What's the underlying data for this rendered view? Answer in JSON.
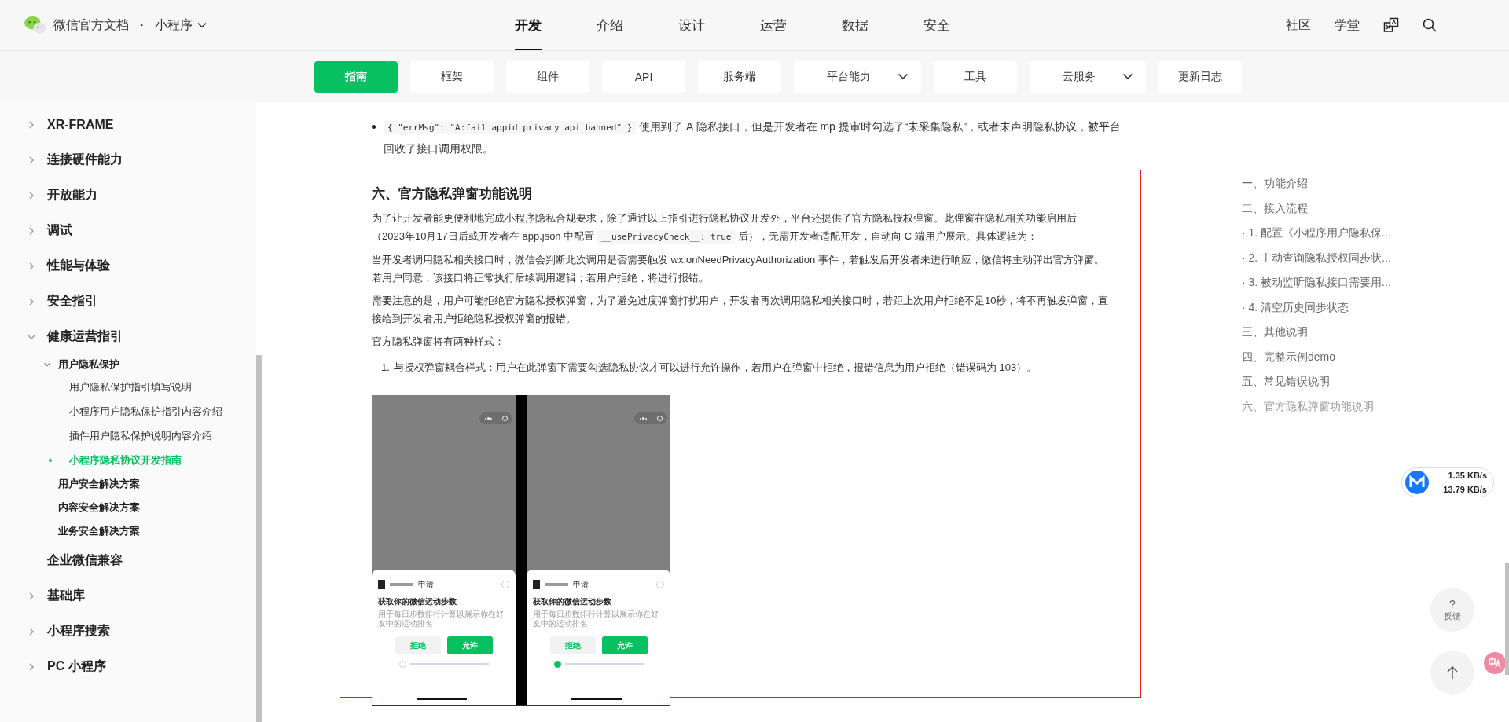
{
  "header": {
    "site_title": "微信官方文档",
    "separator": "·",
    "product": "小程序",
    "nav": [
      {
        "label": "开发",
        "selected": true
      },
      {
        "label": "介绍",
        "selected": false
      },
      {
        "label": "设计",
        "selected": false
      },
      {
        "label": "运营",
        "selected": false
      },
      {
        "label": "数据",
        "selected": false
      },
      {
        "label": "安全",
        "selected": false
      }
    ],
    "links": [
      "社区",
      "学堂"
    ]
  },
  "subnav": [
    {
      "label": "指南",
      "selected": true,
      "dropdown": false
    },
    {
      "label": "框架",
      "selected": false,
      "dropdown": false
    },
    {
      "label": "组件",
      "selected": false,
      "dropdown": false
    },
    {
      "label": "API",
      "selected": false,
      "dropdown": false
    },
    {
      "label": "服务端",
      "selected": false,
      "dropdown": false
    },
    {
      "label": "平台能力",
      "selected": false,
      "dropdown": true
    },
    {
      "label": "工具",
      "selected": false,
      "dropdown": false
    },
    {
      "label": "云服务",
      "selected": false,
      "dropdown": true
    },
    {
      "label": "更新日志",
      "selected": false,
      "dropdown": false
    }
  ],
  "sidebar": {
    "items": [
      {
        "label": "XR-FRAME",
        "kind": "group",
        "expanded": false
      },
      {
        "label": "连接硬件能力",
        "kind": "group",
        "expanded": false
      },
      {
        "label": "开放能力",
        "kind": "group",
        "expanded": false
      },
      {
        "label": "调试",
        "kind": "group",
        "expanded": false
      },
      {
        "label": "性能与体验",
        "kind": "group",
        "expanded": false
      },
      {
        "label": "安全指引",
        "kind": "group",
        "expanded": false
      },
      {
        "label": "健康运营指引",
        "kind": "group",
        "expanded": true,
        "children": [
          {
            "label": "用户隐私保护",
            "kind": "group",
            "expanded": true,
            "children": [
              {
                "label": "用户隐私保护指引填写说明",
                "selected": false
              },
              {
                "label": "小程序用户隐私保护指引内容介绍",
                "selected": false
              },
              {
                "label": "插件用户隐私保护说明内容介绍",
                "selected": false
              },
              {
                "label": "小程序隐私协议开发指南",
                "selected": true
              }
            ]
          },
          {
            "label": "用户安全解决方案",
            "kind": "heading"
          },
          {
            "label": "内容安全解决方案",
            "kind": "heading"
          },
          {
            "label": "业务安全解决方案",
            "kind": "heading"
          }
        ]
      },
      {
        "label": "企业微信兼容",
        "kind": "leaf"
      },
      {
        "label": "基础库",
        "kind": "group",
        "expanded": false
      },
      {
        "label": "小程序搜索",
        "kind": "group",
        "expanded": false
      },
      {
        "label": "PC 小程序",
        "kind": "group",
        "expanded": false
      }
    ]
  },
  "content": {
    "bullets": [
      [
        {
          "kind": "code",
          "text": "{ \"errMsg\": \"A:fail appid privacy api banned\" }"
        },
        {
          "kind": "text",
          "text": " 使用到了 A 隐私接口，但是开发者在 mp 提审时勾选了“未采集隐私”，或者未声明隐私协议，被平台回收了接口调用权限。"
        }
      ]
    ],
    "section": {
      "heading": "六、官方隐私弹窗功能说明",
      "paragraphs": [
        [
          {
            "kind": "text",
            "text": "为了让开发者能更便利地完成小程序隐私合规要求，除了通过以上指引进行隐私协议开发外，平台还提供了官方隐私授权弹窗。此弹窗在隐私相关功能启用后（2023年10月17日后或开发者在 app.json 中配置 "
          },
          {
            "kind": "code",
            "text": "__usePrivacyCheck__: true"
          },
          {
            "kind": "text",
            "text": " 后），无需开发者适配开发，自动向 C 端用户展示。具体逻辑为："
          }
        ],
        [
          {
            "kind": "text",
            "text": "当开发者调用隐私相关接口时，微信会判断此次调用是否需要触发 wx.onNeedPrivacyAuthorization 事件，若触发后开发者未进行响应，微信将主动弹出官方弹窗。若用户同意，该接口将正常执行后续调用逻辑；若用户拒绝，将进行报错。"
          }
        ],
        [
          {
            "kind": "text",
            "text": "需要注意的是，用户可能拒绝官方隐私授权弹窗，为了避免过度弹窗打扰用户，开发者再次调用隐私相关接口时，若距上次用户拒绝不足10秒，将不再触发弹窗，直接给到开发者用户拒绝隐私授权弹窗的报错。"
          }
        ],
        [
          {
            "kind": "text",
            "text": "官方隐私弹窗将有两种样式："
          }
        ]
      ],
      "ordered": [
        {
          "number": "1.",
          "text": "与授权弹窗耦合样式：用户在此弹窗下需要勾选隐私协议才可以进行允许操作，若用户在弹窗中拒绝，报错信息为用户拒绝（错误码为 103）。"
        }
      ],
      "phones": [
        {
          "applies": "申请",
          "title": "获取你的微信运动步数",
          "desc": "用于每日步数排行计算以展示你在好友中的运动排名",
          "reject": "拒绝",
          "allow": "允许",
          "consent_checked": false
        },
        {
          "applies": "申请",
          "title": "获取你的微信运动步数",
          "desc": "用于每日步数排行计算以展示你在好友中的运动排名",
          "reject": "拒绝",
          "allow": "允许",
          "consent_checked": true
        }
      ]
    }
  },
  "toc": [
    {
      "label": "一、功能介绍",
      "selected": false
    },
    {
      "label": "二、接入流程",
      "selected": false
    },
    {
      "label": "· 1. 配置《小程序用户隐私保...",
      "selected": false
    },
    {
      "label": "· 2. 主动查询隐私授权同步状...",
      "selected": false
    },
    {
      "label": "· 3. 被动监听隐私接口需要用...",
      "selected": false
    },
    {
      "label": "· 4. 清空历史同步状态",
      "selected": false
    },
    {
      "label": "三、其他说明",
      "selected": false
    },
    {
      "label": "四、完整示例demo",
      "selected": false
    },
    {
      "label": "五、常见错误说明",
      "selected": false
    },
    {
      "label": "六、官方隐私弹窗功能说明",
      "selected": true
    }
  ],
  "speed_widget": {
    "upload": "1.35 KB/s",
    "download": "13.79 KB/s"
  },
  "feedback": {
    "symbol": "?",
    "label": "反馈"
  }
}
